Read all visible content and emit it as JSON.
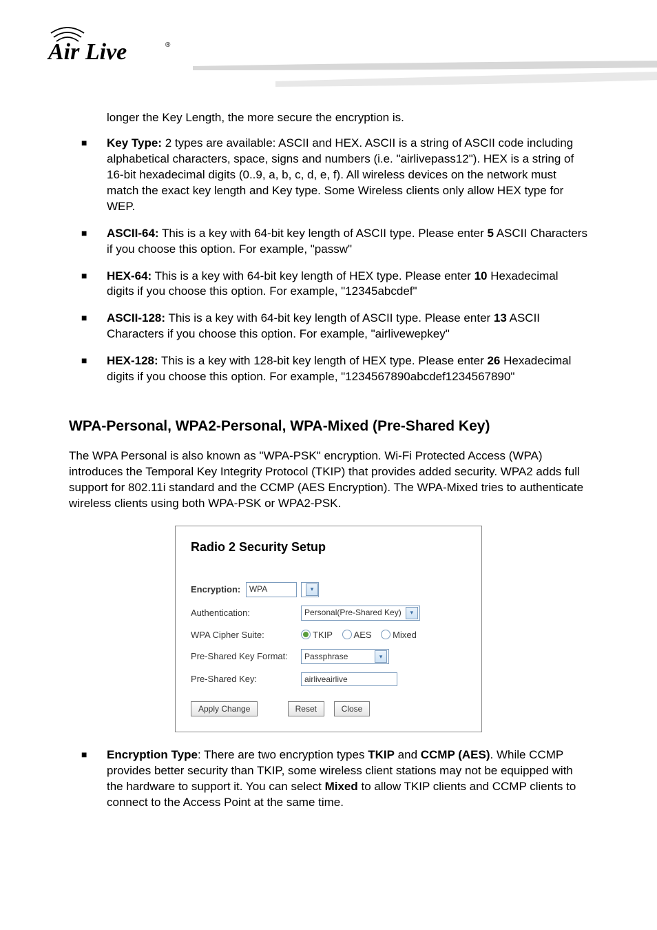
{
  "logo_text": "Air Live",
  "intro_continuation": "longer the Key Length, the more secure the encryption is.",
  "bullets1": [
    {
      "title": "Key Type:",
      "body": "  2 types are available: ASCII and HEX.   ASCII is a string of ASCII code including alphabetical characters, space, signs and numbers (i.e. \"airlivepass12\").   HEX is a string of 16-bit hexadecimal digits (0..9, a, b, c, d, e, f). All wireless devices on the network must match the exact key length and Key type. Some Wireless clients only allow HEX type for WEP."
    },
    {
      "title": "ASCII-64:",
      "body": " This is a key with 64-bit key length of ASCII type.   Please enter ",
      "bold_num": "5",
      "tail": " ASCII Characters if you choose this option. For example, \"passw\""
    },
    {
      "title": "HEX-64:",
      "body": " This is a key with 64-bit key length of HEX type.   Please enter ",
      "bold_num": "10",
      "tail": " Hexadecimal digits if you choose this option. For example, \"12345abcdef\""
    },
    {
      "title": "ASCII-128:",
      "body": " This is a key with 64-bit key length of ASCII type.   Please enter ",
      "bold_num": "13",
      "tail": " ASCII Characters if you choose this option. For example, \"airlivewepkey\""
    },
    {
      "title": "HEX-128:",
      "body": " This is a key with 128-bit key length of HEX type.   Please enter ",
      "bold_num": "26",
      "tail": " Hexadecimal digits if you choose this option. For example, \"1234567890abcdef1234567890\""
    }
  ],
  "section_heading": "WPA-Personal, WPA2-Personal, WPA-Mixed (Pre-Shared Key)",
  "section_para": "The WPA Personal is also known as \"WPA-PSK\" encryption.   Wi-Fi Protected Access (WPA) introduces the Temporal Key Integrity Protocol (TKIP) that provides added security.   WPA2 adds full support for 802.11i standard and the CCMP (AES Encryption). The WPA-Mixed tries to authenticate wireless clients using both WPA-PSK or WPA2-PSK.",
  "dialog": {
    "title": "Radio 2 Security Setup",
    "encryption_label": "Encryption:",
    "encryption_value": "WPA",
    "auth_label": "Authentication:",
    "auth_value": "Personal(Pre-Shared Key)",
    "cipher_label": "WPA Cipher Suite:",
    "cipher_options": {
      "tkip": "TKIP",
      "aes": "AES",
      "mixed": "Mixed"
    },
    "cipher_selected": "tkip",
    "psk_format_label": "Pre-Shared Key Format:",
    "psk_format_value": "Passphrase",
    "psk_label": "Pre-Shared Key:",
    "psk_value": "airliveairlive",
    "buttons": {
      "apply": "Apply Change",
      "reset": "Reset",
      "close": "Close"
    }
  },
  "bullet2": {
    "title": "Encryption Type",
    "body_pre": ":   There are two encryption types ",
    "bold1": "TKIP",
    "mid": " and ",
    "bold2": "CCMP (AES)",
    "body_post": ". While CCMP provides better security than TKIP, some wireless client stations may not be equipped with the hardware to support it. You can select ",
    "bold3": "Mixed",
    "tail": " to allow TKIP clients and CCMP clients to connect to the Access Point at the same time."
  }
}
